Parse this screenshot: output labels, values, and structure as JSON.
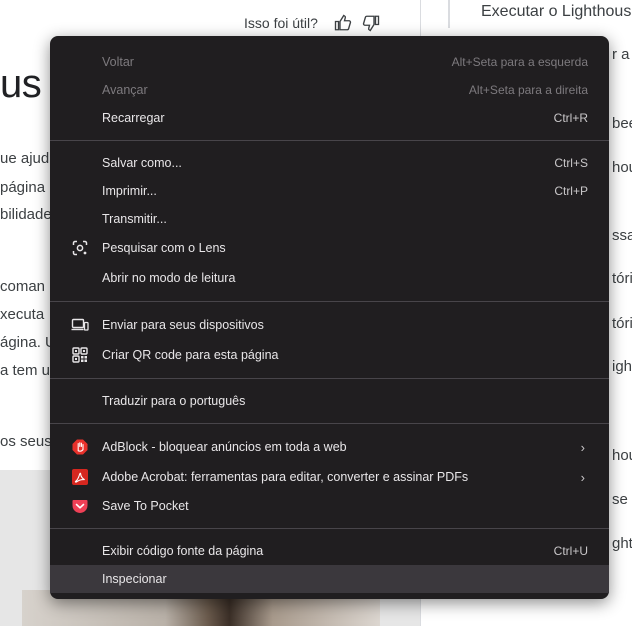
{
  "background": {
    "feedback_label": "Isso foi útil?",
    "heading_fragment": "us",
    "toc_top": "Executar o Lighthous",
    "left_fragments": [
      "ue ajud",
      "página",
      "bilidade",
      "coman",
      "xecuta",
      "ágina. U",
      "a tem u",
      "os seus"
    ],
    "right_fragments": [
      "r a",
      "bee",
      "hous",
      "ssar",
      "tóri",
      "tóri",
      "igh",
      "hous",
      "se",
      "ghtl"
    ]
  },
  "menu": {
    "sections": [
      [
        {
          "label": "Voltar",
          "shortcut": "Alt+Seta para a esquerda",
          "disabled": true
        },
        {
          "label": "Avançar",
          "shortcut": "Alt+Seta para a direita",
          "disabled": true
        },
        {
          "label": "Recarregar",
          "shortcut": "Ctrl+R"
        }
      ],
      [
        {
          "label": "Salvar como...",
          "shortcut": "Ctrl+S"
        },
        {
          "label": "Imprimir...",
          "shortcut": "Ctrl+P"
        },
        {
          "label": "Transmitir..."
        },
        {
          "label": "Pesquisar com o Lens",
          "icon": "lens-icon"
        },
        {
          "label": "Abrir no modo de leitura"
        }
      ],
      [
        {
          "label": "Enviar para seus dispositivos",
          "icon": "devices-icon"
        },
        {
          "label": "Criar QR code para esta página",
          "icon": "qr-code-icon"
        }
      ],
      [
        {
          "label": "Traduzir para o português"
        }
      ],
      [
        {
          "label": "AdBlock - bloquear anúncios em toda a web",
          "icon": "adblock-icon",
          "submenu": true
        },
        {
          "label": "Adobe Acrobat: ferramentas para editar, converter e assinar PDFs",
          "icon": "acrobat-icon",
          "submenu": true
        },
        {
          "label": "Save To Pocket",
          "icon": "pocket-icon"
        }
      ],
      [
        {
          "label": "Exibir código fonte da página",
          "shortcut": "Ctrl+U"
        },
        {
          "label": "Inspecionar",
          "highlighted": true
        }
      ]
    ]
  },
  "colors": {
    "menu_bg": "#201e20",
    "menu_text": "#e8e6e8",
    "disabled_text": "#7d7a7e",
    "highlight_bg": "#3b383d",
    "adblock_red": "#e8312b",
    "acrobat_red": "#d6271f",
    "pocket_pink": "#ef4056"
  }
}
